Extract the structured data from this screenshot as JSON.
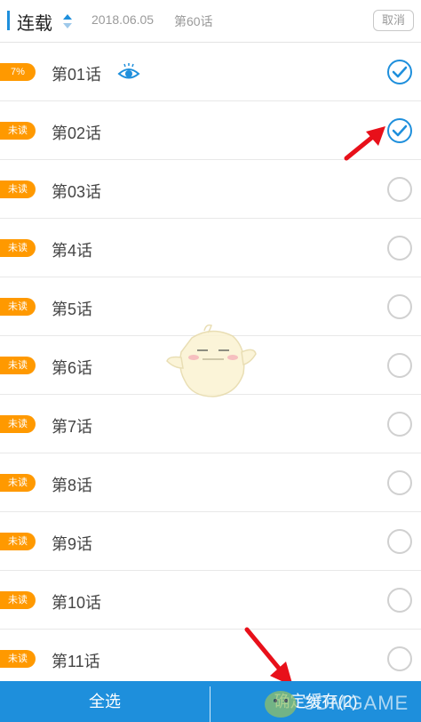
{
  "header": {
    "title": "连载",
    "date": "2018.06.05",
    "latest": "第60话",
    "cancel_label": "取消"
  },
  "chapters": [
    {
      "label": "第01话",
      "badge": "7%",
      "reading": true,
      "selected": true
    },
    {
      "label": "第02话",
      "badge": "未读",
      "selected": true
    },
    {
      "label": "第03话",
      "badge": "未读",
      "selected": false
    },
    {
      "label": "第4话",
      "badge": "未读",
      "selected": false
    },
    {
      "label": "第5话",
      "badge": "未读",
      "selected": false
    },
    {
      "label": "第6话",
      "badge": "未读",
      "selected": false
    },
    {
      "label": "第7话",
      "badge": "未读",
      "selected": false
    },
    {
      "label": "第8话",
      "badge": "未读",
      "selected": false
    },
    {
      "label": "第9话",
      "badge": "未读",
      "selected": false
    },
    {
      "label": "第10话",
      "badge": "未读",
      "selected": false
    },
    {
      "label": "第11话",
      "badge": "未读",
      "selected": false
    }
  ],
  "bottom": {
    "select_all_label": "全选",
    "confirm_label": "确定缓存(2)"
  },
  "watermark": {
    "text": "3DMGAME"
  },
  "colors": {
    "accent": "#1e8fdc",
    "badge": "#ff9900",
    "annotation_arrow": "#e8101a"
  },
  "icons": [
    "sort-icon",
    "eye-icon",
    "check-circle-icon",
    "empty-circle-icon",
    "mascot-sticker",
    "red-arrow"
  ]
}
